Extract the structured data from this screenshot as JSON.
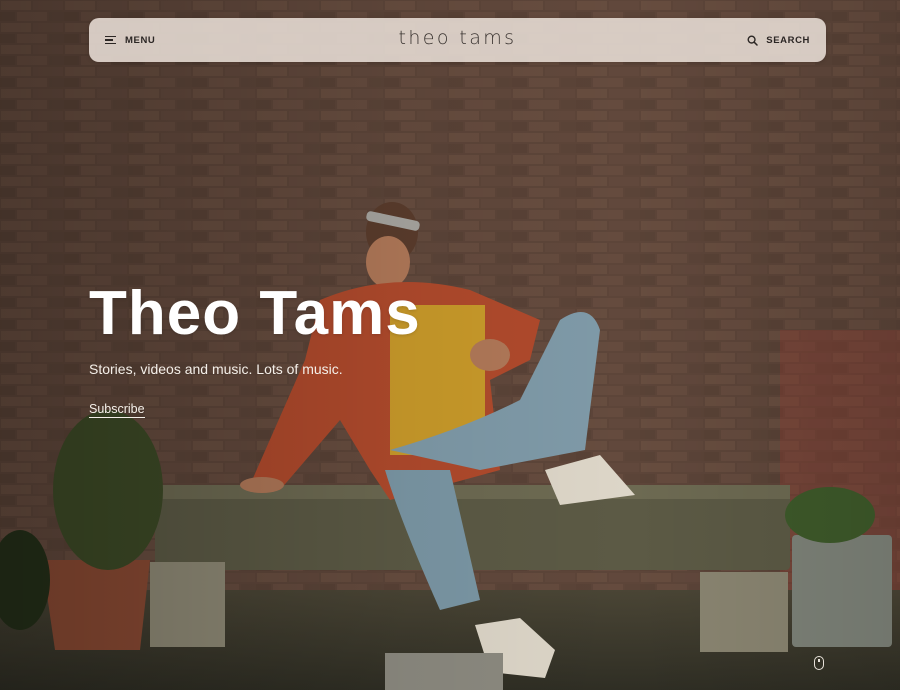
{
  "nav": {
    "menu_label": "MENU",
    "menu_icon": "hamburger-icon",
    "site_name": "theo tams",
    "search_label": "SEARCH",
    "search_icon": "search-icon"
  },
  "hero": {
    "title": "Theo Tams",
    "subtitle": "Stories, videos and music. Lots of music.",
    "subscribe_label": "Subscribe",
    "scroll_icon": "mouse-scroll-icon"
  }
}
